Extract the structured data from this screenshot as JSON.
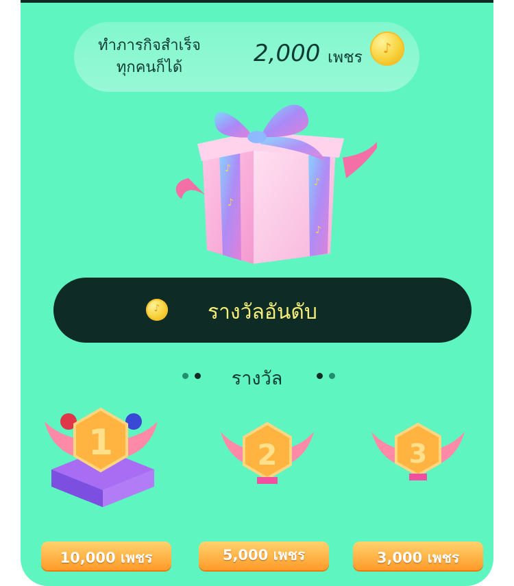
{
  "banner": {
    "line1": "ทำภารกิจสำเร็จ",
    "line2": "ทุกคนก็ได้",
    "amount": "2,000",
    "unit": "เพชร",
    "coin_icon": "music-note-coin-icon"
  },
  "gift": {
    "icon": "gift-box-icon"
  },
  "ranking_button": {
    "label": "รางวัลอันดับ",
    "icon": "music-note-coin-icon"
  },
  "rewards_section": {
    "title": "รางวัล",
    "items": [
      {
        "rank": "1",
        "amount": "10,000 เพชร",
        "badge": "rank-1-medal-icon"
      },
      {
        "rank": "2",
        "amount": "5,000 เพชร",
        "badge": "rank-2-medal-icon"
      },
      {
        "rank": "3",
        "amount": "3,000 เพชร",
        "badge": "rank-3-medal-icon"
      }
    ]
  },
  "colors": {
    "background": "#5ff5c0",
    "dark": "#0e2b25",
    "button_text": "#f7ef79",
    "reward_orange": "#ff9a2a"
  }
}
